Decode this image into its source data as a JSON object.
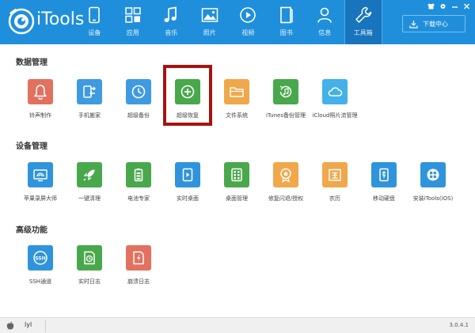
{
  "app": {
    "logo_text": "iTools",
    "download_label": "下载中心",
    "version": "3.0.4.1"
  },
  "nav": [
    {
      "label": "设备",
      "icon": "phone-icon"
    },
    {
      "label": "应用",
      "icon": "apps-grid-icon"
    },
    {
      "label": "音乐",
      "icon": "music-note-icon"
    },
    {
      "label": "照片",
      "icon": "photo-icon"
    },
    {
      "label": "视频",
      "icon": "video-play-icon"
    },
    {
      "label": "图书",
      "icon": "book-icon"
    },
    {
      "label": "信息",
      "icon": "user-icon"
    },
    {
      "label": "工具箱",
      "icon": "wrench-icon",
      "active": true
    }
  ],
  "sections": [
    {
      "title": "数据管理",
      "items": [
        {
          "label": "铃声制作",
          "icon": "bell-icon",
          "color": "#e2715f"
        },
        {
          "label": "手机搬家",
          "icon": "phone-transfer-icon",
          "color": "#3f9be1"
        },
        {
          "label": "超级备份",
          "icon": "clock-backup-icon",
          "color": "#3f9be1"
        },
        {
          "label": "超级恢复",
          "icon": "plus-restore-icon",
          "color": "#48a84b"
        },
        {
          "label": "文件系统",
          "icon": "folder-icon",
          "color": "#f0a84a"
        },
        {
          "label": "iTunes备份管理",
          "icon": "music-backup-icon",
          "color": "#48a84b"
        },
        {
          "label": "iCloud照片流管理",
          "icon": "cloud-icon",
          "color": "#44b1e8"
        }
      ]
    },
    {
      "title": "设备管理",
      "items": [
        {
          "label": "苹果录屏大师",
          "icon": "screen-cast-icon",
          "color": "#2f94db"
        },
        {
          "label": "一键清理",
          "icon": "rocket-icon",
          "color": "#48a84b"
        },
        {
          "label": "电池专家",
          "icon": "battery-icon",
          "color": "#48a84b"
        },
        {
          "label": "实时桌面",
          "icon": "play-screen-icon",
          "color": "#2f94db"
        },
        {
          "label": "桌面管理",
          "icon": "grid-manage-icon",
          "color": "#48a84b"
        },
        {
          "label": "修复闪退/授权",
          "icon": "badge-icon",
          "color": "#f0a84a"
        },
        {
          "label": "农历",
          "icon": "calendar-icon",
          "color": "#f0a84a"
        },
        {
          "label": "移动硬盘",
          "icon": "usb-drive-icon",
          "color": "#2f94db"
        },
        {
          "label": "安装iTools(iOS)",
          "icon": "itools-ios-icon",
          "color": "#2f94db"
        }
      ]
    },
    {
      "title": "高级功能",
      "items": [
        {
          "label": "SSH通道",
          "icon": "ssh-icon",
          "color": "#2f94db"
        },
        {
          "label": "实时日志",
          "icon": "realtime-log-icon",
          "color": "#48a84b"
        },
        {
          "label": "崩溃日志",
          "icon": "crash-log-icon",
          "color": "#e2715f"
        }
      ]
    }
  ],
  "status": {
    "user": "lyl"
  }
}
